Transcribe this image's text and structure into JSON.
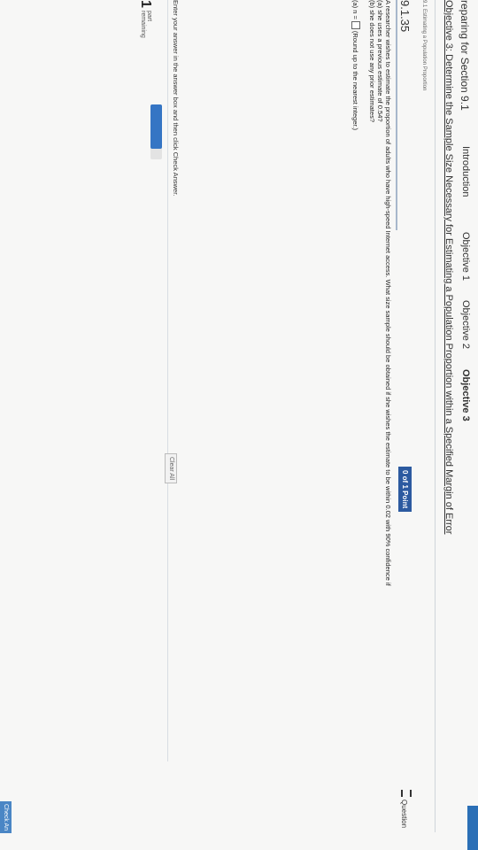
{
  "header": {
    "section_title": "reparing for Section 9.1",
    "corner_badge": "",
    "tabs": [
      {
        "label": "Introduction"
      },
      {
        "label": "Objective 1"
      },
      {
        "label": "Objective 2"
      },
      {
        "label": "Objective 3",
        "active": true
      }
    ],
    "objective_title": "Objective 3: Determine the Sample Size Necessary for Estimating a Population Proportion within a Specified Margin of Error",
    "sub_title": "9.1 Estimating a Population Proportion"
  },
  "question": {
    "id": "9.1.35",
    "points": "0 of 1 Point",
    "question_button": "Question",
    "text_lines": [
      "A researcher wishes to estimate the proportion of adults who have high-speed Internet access. What size sample should be obtained if she wishes the estimate to be within 0.02 with 90% confidence if",
      "(a) she uses a previous estimate of 0.54?",
      "(b) she does not use any prior estimates?"
    ],
    "answer_prefix": "(a) n =",
    "answer_value": "",
    "answer_hint": "(Round up to the nearest integer.)"
  },
  "footer": {
    "instruction": "Enter your answer in the answer box and then click Check Answer.",
    "parts_count": "1",
    "parts_label_1": "part",
    "parts_label_2": "remaining",
    "progress": 0.8,
    "progress_color": "#3575c4",
    "clear_all": "Clear All",
    "check_answer": "Check An"
  }
}
